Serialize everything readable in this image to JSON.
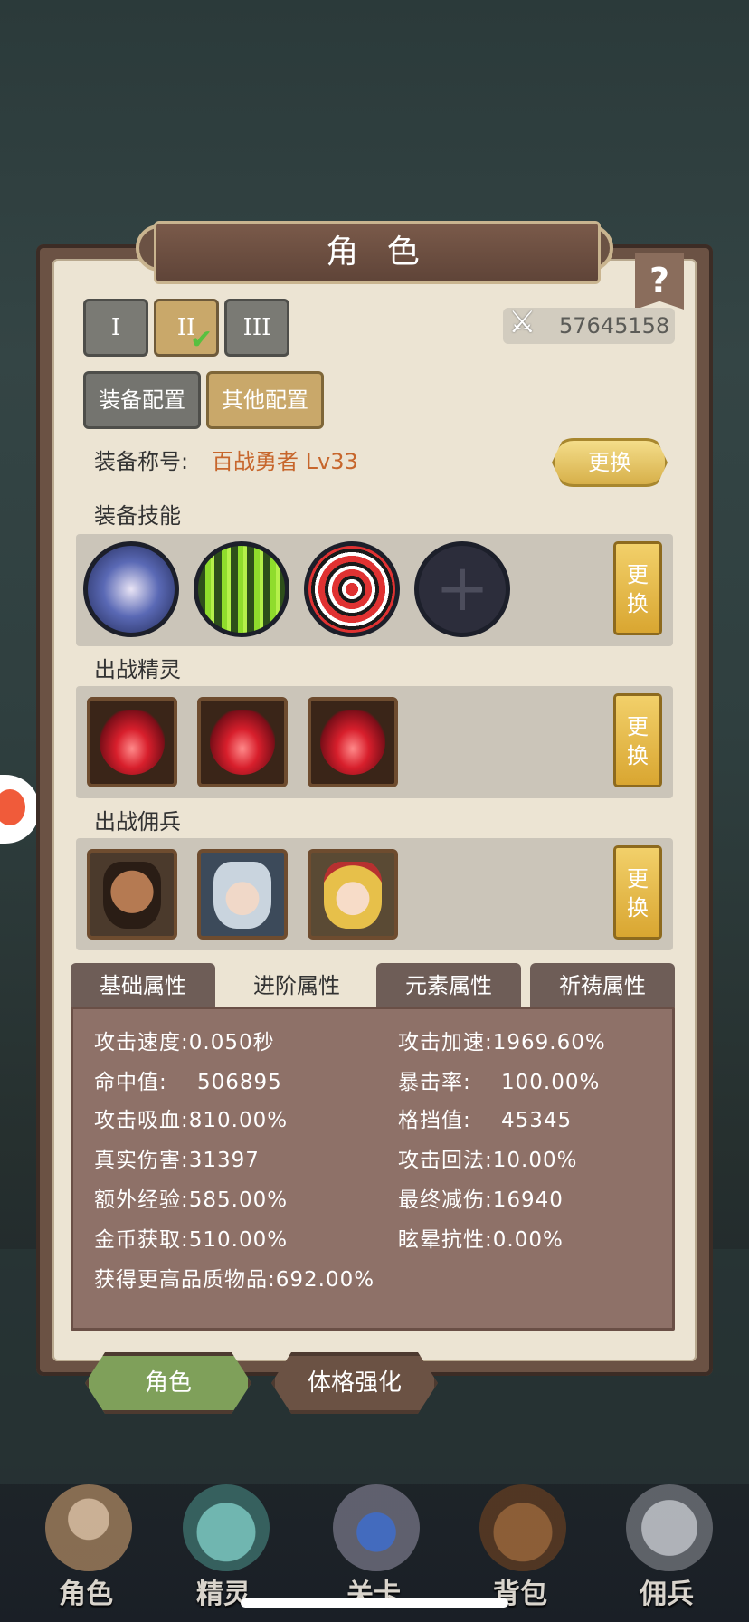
{
  "panel": {
    "title": "角 色",
    "help": "?"
  },
  "loadout_tabs": {
    "tab1": "I",
    "tab2": "II",
    "tab3": "III",
    "selected": "II"
  },
  "power": {
    "value": "57645158"
  },
  "config": {
    "equip": "装备配置",
    "other": "其他配置"
  },
  "equip_title": {
    "label": "装备称号:",
    "value": "百战勇者 Lv33",
    "swap": "更换"
  },
  "skills": {
    "label": "装备技能",
    "swap_line1": "更",
    "swap_line2": "换",
    "add_symbol": "+"
  },
  "spirits": {
    "label": "出战精灵",
    "swap_line1": "更",
    "swap_line2": "换"
  },
  "mercs": {
    "label": "出战佣兵",
    "swap_line1": "更",
    "swap_line2": "换"
  },
  "attr_tabs": [
    "基础属性",
    "进阶属性",
    "元素属性",
    "祈祷属性"
  ],
  "stats": {
    "s1": "攻击速度:0.050秒",
    "s2": "攻击加速:1969.60%",
    "s3": "命中值:    506895",
    "s4": "暴击率:    100.00%",
    "s5": "攻击吸血:810.00%",
    "s6": "格挡值:    45345",
    "s7": "真实伤害:31397",
    "s8": "攻击回法:10.00%",
    "s9": "额外经验:585.00%",
    "s10": "最终减伤:16940",
    "s11": "金币获取:510.00%",
    "s12": "眩晕抗性:0.00%",
    "s13": "获得更高品质物品:692.00%"
  },
  "bottom_tabs": {
    "role": "角色",
    "physique": "体格强化"
  },
  "nav": [
    "角色",
    "精灵",
    "关卡",
    "背包",
    "佣兵"
  ],
  "colors": {
    "panel_bg": "#ece4d3",
    "accent_gold": "#d9a631",
    "title_orange": "#c7662c",
    "stats_bg": "#8e7168",
    "active_green": "#7fa05a"
  }
}
